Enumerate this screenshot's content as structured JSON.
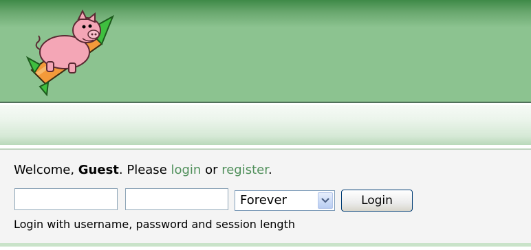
{
  "header": {
    "logo_icon": "flying-pig-rocket-logo"
  },
  "userbox": {
    "welcome_prefix": "Welcome, ",
    "guest_name": "Guest",
    "please_text": ". Please ",
    "login_link": "login",
    "or_text": " or ",
    "register_link": "register",
    "period": ".",
    "username_value": "",
    "password_value": "",
    "session_length": "Forever",
    "login_button": "Login",
    "hint": "Login with username, password and session length"
  },
  "colors": {
    "header_green": "#8cc390",
    "link_green": "#4f8f5a"
  }
}
